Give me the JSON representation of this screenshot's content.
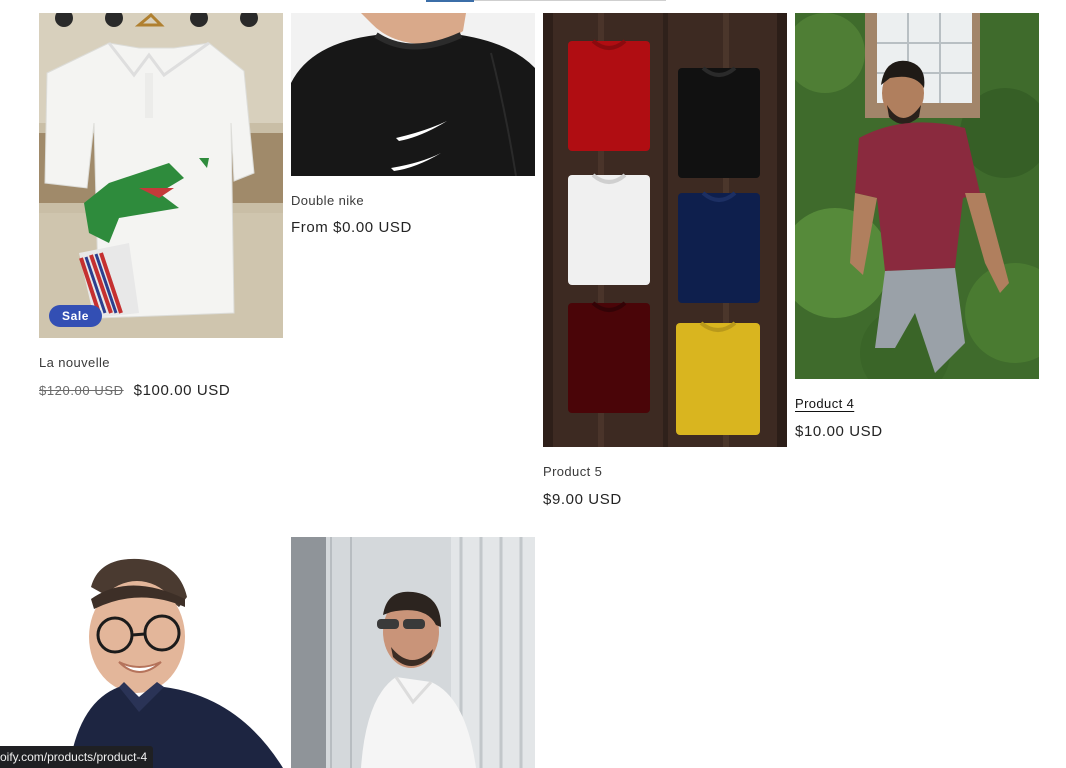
{
  "products": [
    {
      "title": "La nouvelle",
      "badge": "Sale",
      "compare_price": "$120.00 USD",
      "price": "$100.00 USD",
      "image": "white-lacoste-polo-with-crocodile-print"
    },
    {
      "title": "Double nike",
      "price": "From $0.00 USD",
      "image": "man-in-black-nike-sweatshirt"
    },
    {
      "title": "Product 5",
      "price": "$9.00 USD",
      "image": "folded-colored-tshirts-on-wood"
    },
    {
      "title": "Product 4",
      "price": "$10.00 USD",
      "image": "man-in-maroon-polo-by-ivy-wall"
    },
    {
      "image": "smiling-man-in-glasses-navy-shirt"
    },
    {
      "image": "man-in-sunglasses-white-shirt"
    }
  ],
  "status_bar": {
    "url": "oify.com/products/product-4"
  },
  "colors": {
    "sale_badge": "#334fb4",
    "status_bar_bg": "#1f2023",
    "tab_indicator": "#3b6ea8"
  }
}
